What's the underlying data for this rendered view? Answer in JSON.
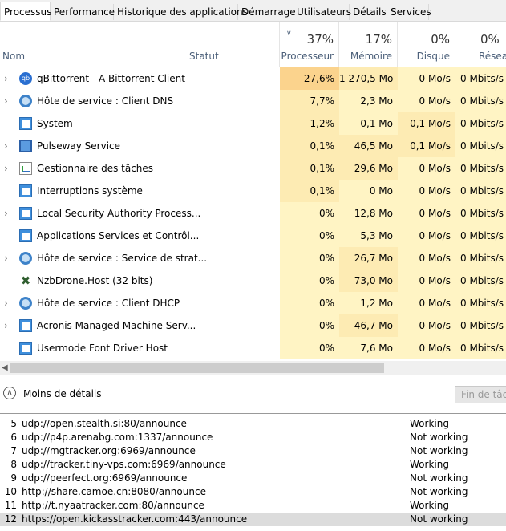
{
  "tabs": [
    "Processus",
    "Performance",
    "Historique des applications",
    "Démarrage",
    "Utilisateurs",
    "Détails",
    "Services"
  ],
  "header": {
    "name_label": "Nom",
    "status_label": "Statut",
    "cpu_pct": "37%",
    "cpu_label": "Processeur",
    "mem_pct": "17%",
    "mem_label": "Mémoire",
    "disk_pct": "0%",
    "disk_label": "Disque",
    "net_pct": "0%",
    "net_label": "Réseau"
  },
  "processes": [
    {
      "name": "qBittorrent - A Bittorrent Client",
      "icon": "qbittorrent-icon",
      "expandable": true,
      "cpu": "27,6%",
      "mem": "1 270,5 Mo",
      "disk": "0 Mo/s",
      "net": "0 Mbits/s"
    },
    {
      "name": "Hôte de service : Client DNS",
      "icon": "gear-icon",
      "expandable": true,
      "cpu": "7,7%",
      "mem": "2,3 Mo",
      "disk": "0 Mo/s",
      "net": "0 Mbits/s"
    },
    {
      "name": "System",
      "icon": "window-icon",
      "expandable": false,
      "cpu": "1,2%",
      "mem": "0,1 Mo",
      "disk": "0,1 Mo/s",
      "net": "0 Mbits/s"
    },
    {
      "name": "Pulseway Service",
      "icon": "monitor-icon",
      "expandable": true,
      "cpu": "0,1%",
      "mem": "46,5 Mo",
      "disk": "0,1 Mo/s",
      "net": "0 Mbits/s"
    },
    {
      "name": "Gestionnaire des tâches",
      "icon": "task-manager-icon",
      "expandable": true,
      "cpu": "0,1%",
      "mem": "29,6 Mo",
      "disk": "0 Mo/s",
      "net": "0 Mbits/s"
    },
    {
      "name": "Interruptions système",
      "icon": "window-icon",
      "expandable": false,
      "cpu": "0,1%",
      "mem": "0 Mo",
      "disk": "0 Mo/s",
      "net": "0 Mbits/s"
    },
    {
      "name": "Local Security Authority Process...",
      "icon": "window-icon",
      "expandable": true,
      "cpu": "0%",
      "mem": "12,8 Mo",
      "disk": "0 Mo/s",
      "net": "0 Mbits/s"
    },
    {
      "name": "Applications Services et Contrôl...",
      "icon": "window-icon",
      "expandable": false,
      "cpu": "0%",
      "mem": "5,3 Mo",
      "disk": "0 Mo/s",
      "net": "0 Mbits/s"
    },
    {
      "name": "Hôte de service : Service de strat...",
      "icon": "gear-icon",
      "expandable": true,
      "cpu": "0%",
      "mem": "26,7 Mo",
      "disk": "0 Mo/s",
      "net": "0 Mbits/s"
    },
    {
      "name": "NzbDrone.Host (32 bits)",
      "icon": "nzbdrone-icon",
      "expandable": false,
      "cpu": "0%",
      "mem": "73,0 Mo",
      "disk": "0 Mo/s",
      "net": "0 Mbits/s"
    },
    {
      "name": "Hôte de service : Client DHCP",
      "icon": "gear-icon",
      "expandable": true,
      "cpu": "0%",
      "mem": "1,2 Mo",
      "disk": "0 Mo/s",
      "net": "0 Mbits/s"
    },
    {
      "name": "Acronis Managed Machine Serv...",
      "icon": "window-icon",
      "expandable": true,
      "cpu": "0%",
      "mem": "46,7 Mo",
      "disk": "0 Mo/s",
      "net": "0 Mbits/s"
    },
    {
      "name": "Usermode Font Driver Host",
      "icon": "window-icon",
      "expandable": false,
      "cpu": "0%",
      "mem": "7,6 Mo",
      "disk": "0 Mo/s",
      "net": "0 Mbits/s"
    }
  ],
  "footer": {
    "less_details": "Moins de détails",
    "end_task": "Fin de tâche"
  },
  "trackers": [
    {
      "num": "5",
      "url": "udp://open.stealth.si:80/announce",
      "status": "Working"
    },
    {
      "num": "6",
      "url": "udp://p4p.arenabg.com:1337/announce",
      "status": "Not working"
    },
    {
      "num": "7",
      "url": "udp://mgtracker.org:6969/announce",
      "status": "Not working"
    },
    {
      "num": "8",
      "url": "udp://tracker.tiny-vps.com:6969/announce",
      "status": "Working"
    },
    {
      "num": "9",
      "url": "udp://peerfect.org:6969/announce",
      "status": "Not working"
    },
    {
      "num": "10",
      "url": "http://share.camoe.cn:8080/announce",
      "status": "Not working"
    },
    {
      "num": "11",
      "url": "http://t.nyaatracker.com:80/announce",
      "status": "Working"
    },
    {
      "num": "12",
      "url": "https://open.kickasstracker.com:443/announce",
      "status": "Not working"
    }
  ],
  "colors": {
    "heat_high": "#fbd38d",
    "heat_mid": "#fdebb3",
    "heat_low": "#fff4c4",
    "header_text": "#4c607a"
  }
}
